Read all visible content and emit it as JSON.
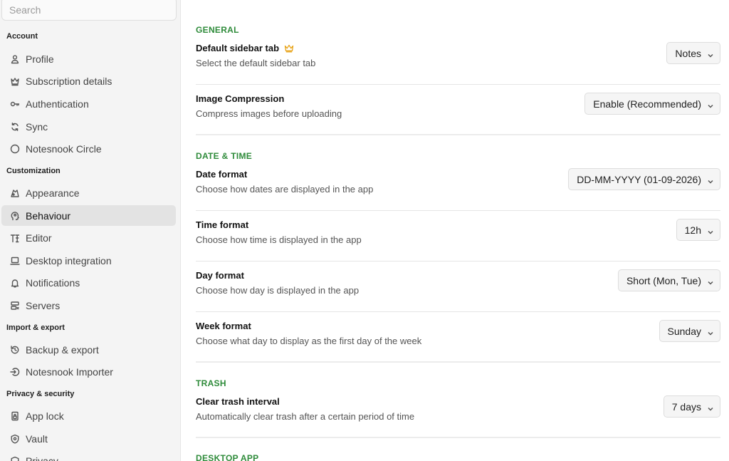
{
  "search": {
    "placeholder": "Search"
  },
  "sidebar": {
    "groups": [
      {
        "title": "Account",
        "items": [
          {
            "label": "Profile",
            "icon": "user-icon"
          },
          {
            "label": "Subscription details",
            "icon": "crown-icon"
          },
          {
            "label": "Authentication",
            "icon": "key-icon"
          },
          {
            "label": "Sync",
            "icon": "sync-icon"
          },
          {
            "label": "Notesnook Circle",
            "icon": "circle-icon"
          }
        ]
      },
      {
        "title": "Customization",
        "items": [
          {
            "label": "Appearance",
            "icon": "palette-icon"
          },
          {
            "label": "Behaviour",
            "icon": "brain-icon",
            "active": true
          },
          {
            "label": "Editor",
            "icon": "editor-icon"
          },
          {
            "label": "Desktop integration",
            "icon": "laptop-icon"
          },
          {
            "label": "Notifications",
            "icon": "bell-icon"
          },
          {
            "label": "Servers",
            "icon": "server-icon"
          }
        ]
      },
      {
        "title": "Import & export",
        "items": [
          {
            "label": "Backup & export",
            "icon": "backup-icon"
          },
          {
            "label": "Notesnook Importer",
            "icon": "import-icon"
          }
        ]
      },
      {
        "title": "Privacy & security",
        "items": [
          {
            "label": "App lock",
            "icon": "lock-icon"
          },
          {
            "label": "Vault",
            "icon": "shield-icon"
          },
          {
            "label": "Privacy",
            "icon": "privacy-icon"
          }
        ]
      }
    ]
  },
  "main": {
    "sections": [
      {
        "title": "GENERAL",
        "rows": [
          {
            "title": "Default sidebar tab",
            "desc": "Select the default sidebar tab",
            "value": "Notes",
            "premium": true
          },
          {
            "title": "Image Compression",
            "desc": "Compress images before uploading",
            "value": "Enable (Recommended)"
          }
        ]
      },
      {
        "title": "DATE & TIME",
        "rows": [
          {
            "title": "Date format",
            "desc": "Choose how dates are displayed in the app",
            "value": "DD-MM-YYYY (01-09-2026)"
          },
          {
            "title": "Time format",
            "desc": "Choose how time is displayed in the app",
            "value": "12h"
          },
          {
            "title": "Day format",
            "desc": "Choose how day is displayed in the app",
            "value": "Short (Mon, Tue)"
          },
          {
            "title": "Week format",
            "desc": "Choose what day to display as the first day of the week",
            "value": "Sunday"
          }
        ]
      },
      {
        "title": "TRASH",
        "rows": [
          {
            "title": "Clear trash interval",
            "desc": "Automatically clear trash after a certain period of time",
            "value": "7 days"
          }
        ]
      },
      {
        "title": "DESKTOP APP",
        "rows": []
      }
    ]
  },
  "colors": {
    "accent": "#2e8b3a",
    "crown": "#e8a317",
    "active_bg": "#e3e3e3"
  }
}
